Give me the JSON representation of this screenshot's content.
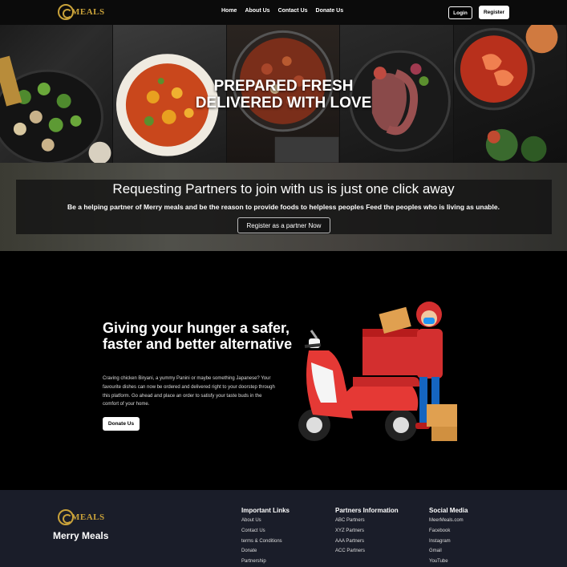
{
  "nav": {
    "logo_text": "MEALS",
    "links": [
      "Home",
      "About Us",
      "Contact Us",
      "Donate Us"
    ],
    "login_label": "Login",
    "register_label": "Register"
  },
  "hero": {
    "title_line1": "PREPARED FRESH",
    "title_line2": "DELIVERED WITH LOVE"
  },
  "partner": {
    "title": "Requesting Partners to join with us is just one click away",
    "subtitle": "Be a helping partner of Merry meals and be the reason to provide foods to helpless peoples Feed the peoples who is living as unable.",
    "button_label": "Register as a partner Now"
  },
  "promo": {
    "title": "Giving your hunger a safer, faster and better alternative",
    "description": "Craving chicken Biryani, a yummy Panini or maybe something Japanese? Your favourite dishes can now be ordered and delivered right to your doorstep through this platform. Go ahead and place an order to satisfy your taste buds in the comfort of your home.",
    "button_label": "Donate Us"
  },
  "footer": {
    "logo_text": "MEALS",
    "brand": "Merry Meals",
    "columns": [
      {
        "title": "Important Links",
        "items": [
          "About Us",
          "Contact Us",
          "terms & Conditions",
          "Donate",
          "Partnership"
        ]
      },
      {
        "title": "Partners Information",
        "items": [
          "ABC Partners",
          "XYZ Partners",
          "AAA Partners",
          "ACC Partners"
        ]
      },
      {
        "title": "Social Media",
        "items": [
          "MeerMeals.com",
          "Facebook",
          "Instagram",
          "Gmail",
          "YouTube"
        ]
      }
    ]
  },
  "colors": {
    "gold": "#c9a23a",
    "footer_bg": "#1a1d29",
    "scooter_red": "#e53935"
  }
}
